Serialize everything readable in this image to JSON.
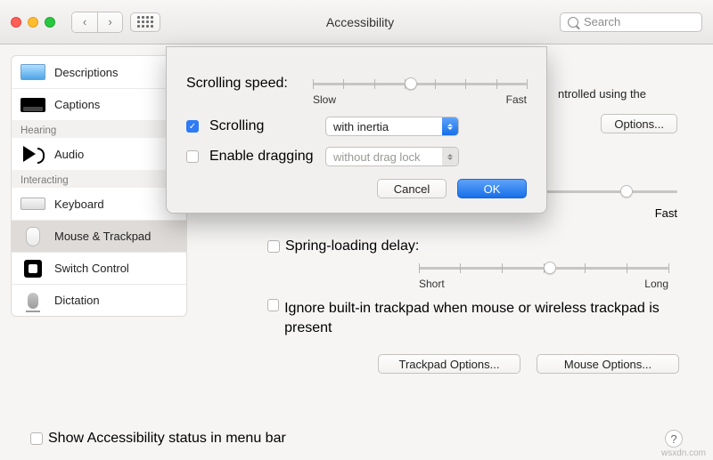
{
  "toolbar": {
    "title": "Accessibility",
    "search_placeholder": "Search"
  },
  "sidebar": {
    "items": [
      {
        "label": "Descriptions"
      },
      {
        "label": "Captions"
      }
    ],
    "cat_hearing": "Hearing",
    "audio_label": "Audio",
    "cat_interacting": "Interacting",
    "interacting": [
      {
        "label": "Keyboard"
      },
      {
        "label": "Mouse & Trackpad",
        "selected": true
      },
      {
        "label": "Switch Control"
      },
      {
        "label": "Dictation"
      }
    ]
  },
  "main": {
    "bg_text_fragment": "ntrolled using the",
    "options_label": "Options...",
    "fast_label": "Fast",
    "spring_label": "Spring-loading delay:",
    "spring_min": "Short",
    "spring_max": "Long",
    "ignore_label": "Ignore built-in trackpad when mouse or wireless trackpad is present",
    "trackpad_options_label": "Trackpad Options...",
    "mouse_options_label": "Mouse Options..."
  },
  "sheet": {
    "scrolling_speed_label": "Scrolling speed:",
    "slow_label": "Slow",
    "fast_label": "Fast",
    "scrolling_cb_label": "Scrolling",
    "scrolling_select_value": "with inertia",
    "dragging_cb_label": "Enable dragging",
    "dragging_select_value": "without drag lock",
    "cancel_label": "Cancel",
    "ok_label": "OK"
  },
  "footer": {
    "show_status_label": "Show Accessibility status in menu bar"
  },
  "watermark": "wsxdn.com"
}
